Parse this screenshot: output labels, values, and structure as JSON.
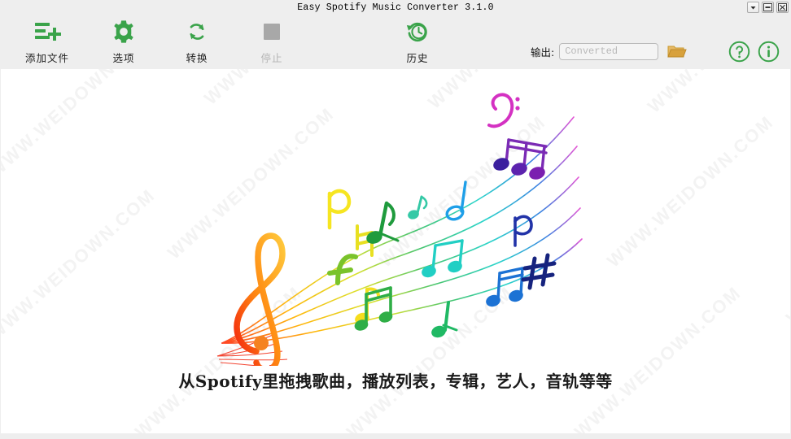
{
  "window": {
    "title": "Easy Spotify Music Converter 3.1.0",
    "controls": [
      {
        "name": "dropdown-button",
        "glyph": "chevron-down-icon"
      },
      {
        "name": "minimize-button",
        "glyph": "minimize-icon"
      },
      {
        "name": "close-button",
        "glyph": "close-icon"
      }
    ]
  },
  "toolbar": {
    "items": [
      {
        "id": "add-files",
        "label": "添加文件",
        "icon": "add-files-icon",
        "enabled": true
      },
      {
        "id": "options",
        "label": "选项",
        "icon": "gear-icon",
        "enabled": true
      },
      {
        "id": "convert",
        "label": "转换",
        "icon": "refresh-icon",
        "enabled": true
      },
      {
        "id": "stop",
        "label": "停止",
        "icon": "stop-square-icon",
        "enabled": false
      },
      {
        "id": "history",
        "label": "历史",
        "icon": "history-clock-icon",
        "enabled": true
      }
    ],
    "output": {
      "label": "输出:",
      "value": "",
      "placeholder": "Converted",
      "browse_icon": "folder-icon"
    },
    "help_icon": "help-circle-icon",
    "info_icon": "info-circle-icon"
  },
  "content": {
    "hint_text": "从Spotify里拖拽歌曲，播放列表，专辑，艺人，音轨等等",
    "illustration": "rainbow-music-notes-staff",
    "watermark_text": "WWW.WEIDOWN.COM"
  },
  "colors": {
    "accent_green": "#3aa34a",
    "disabled_gray": "#a8a8a8",
    "toolbar_bg": "#eeeeee",
    "content_bg": "#ffffff",
    "folder_orange": "#d8a13c",
    "placeholder_gray": "#b9b9b9",
    "watermark_gray": "#f3f3f3"
  }
}
